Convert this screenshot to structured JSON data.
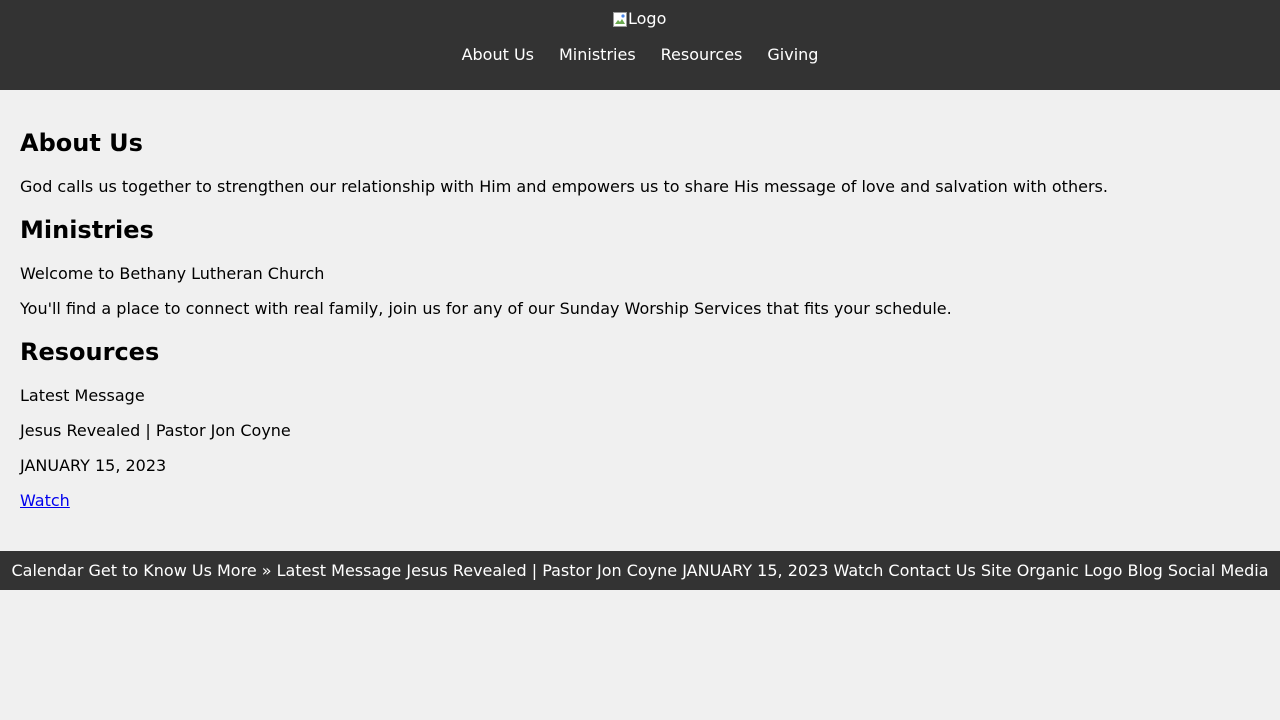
{
  "header": {
    "logo_alt": "Logo",
    "nav": [
      {
        "label": "About Us"
      },
      {
        "label": "Ministries"
      },
      {
        "label": "Resources"
      },
      {
        "label": "Giving"
      }
    ]
  },
  "about": {
    "heading": "About Us",
    "text": "God calls us together to strengthen our relationship with Him and empowers us to share His message of love and salvation with others."
  },
  "ministries": {
    "heading": "Ministries",
    "welcome": "Welcome to Bethany Lutheran Church",
    "text": "You'll find a place to connect with real family, join us for any of our Sunday Worship Services that fits your schedule."
  },
  "resources": {
    "heading": "Resources",
    "latest_label": "Latest Message",
    "message_title": "Jesus Revealed | Pastor Jon Coyne",
    "message_date": "JANUARY 15, 2023",
    "watch_label": "Watch"
  },
  "footer": {
    "text": "Calendar Get to Know Us More » Latest Message Jesus Revealed | Pastor Jon Coyne JANUARY 15, 2023 Watch Contact Us Site Organic Logo Blog Social Media"
  },
  "colors": {
    "header_bg": "#333333",
    "page_bg": "#f0f0f0",
    "link": "#0000ee"
  },
  "icons": {
    "logo": "broken-image-icon"
  }
}
